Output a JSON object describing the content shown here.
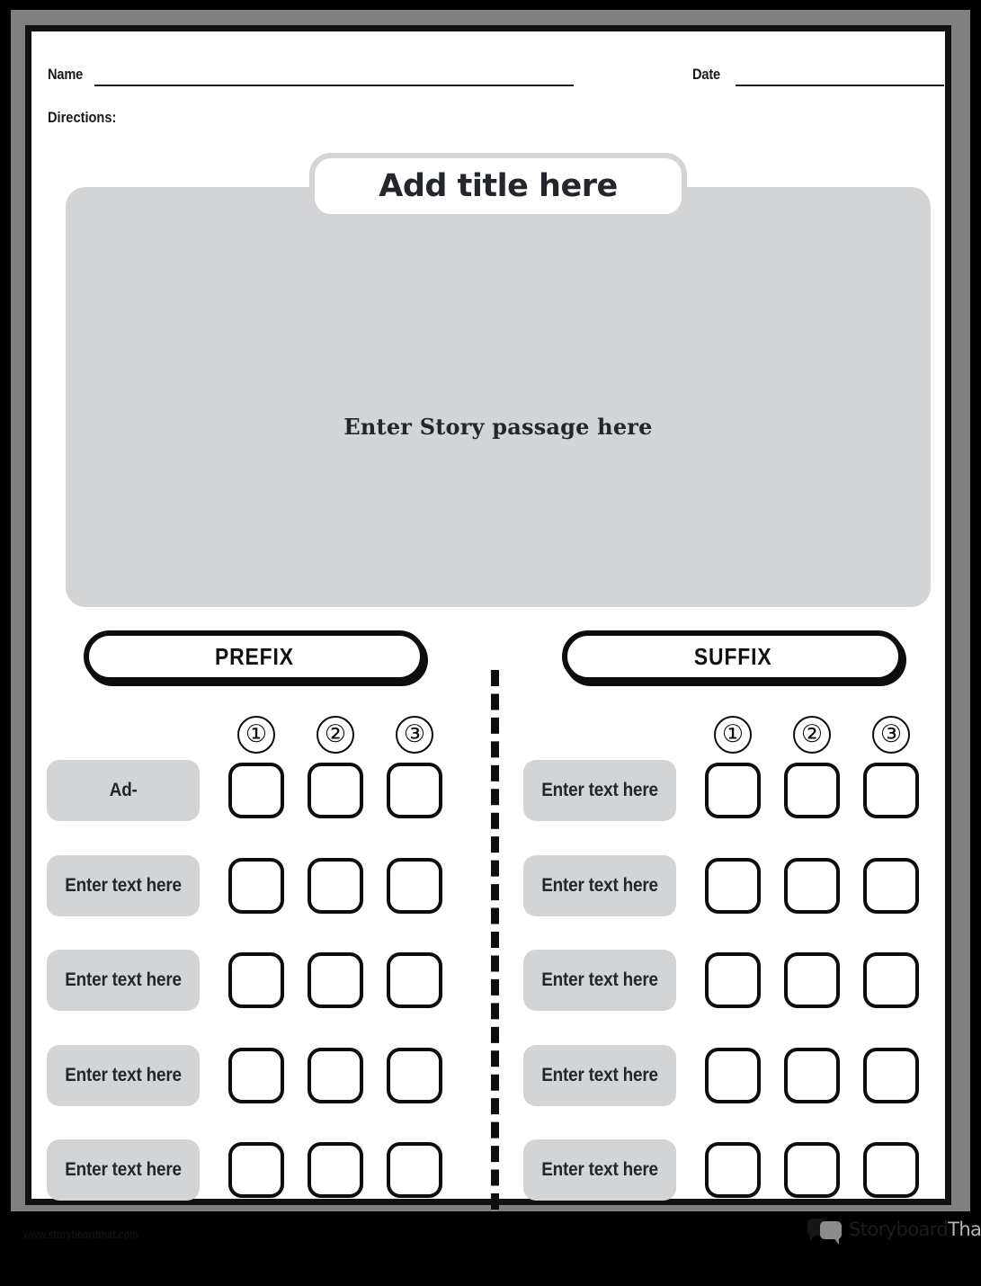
{
  "header": {
    "name_label": "Name",
    "date_label": "Date",
    "name_value": "",
    "date_value": "",
    "directions_label": "Directions:",
    "directions_value": ""
  },
  "title": {
    "placeholder": "Add title here"
  },
  "passage": {
    "placeholder": "Enter Story passage here"
  },
  "sections": {
    "prefix": {
      "heading": "PREFIX",
      "column_numbers": [
        "①",
        "②",
        "③"
      ],
      "rows": [
        {
          "term": "Ad-",
          "answers": [
            "",
            "",
            ""
          ]
        },
        {
          "term": "Enter text here",
          "answers": [
            "",
            "",
            ""
          ]
        },
        {
          "term": "Enter text here",
          "answers": [
            "",
            "",
            ""
          ]
        },
        {
          "term": "Enter text here",
          "answers": [
            "",
            "",
            ""
          ]
        },
        {
          "term": "Enter text here",
          "answers": [
            "",
            "",
            ""
          ]
        }
      ]
    },
    "suffix": {
      "heading": "SUFFIX",
      "column_numbers": [
        "①",
        "②",
        "③"
      ],
      "rows": [
        {
          "term": "Enter text here",
          "answers": [
            "",
            "",
            ""
          ]
        },
        {
          "term": "Enter text here",
          "answers": [
            "",
            "",
            ""
          ]
        },
        {
          "term": "Enter text here",
          "answers": [
            "",
            "",
            ""
          ]
        },
        {
          "term": "Enter text here",
          "answers": [
            "",
            "",
            ""
          ]
        },
        {
          "term": "Enter text here",
          "answers": [
            "",
            "",
            ""
          ]
        }
      ]
    }
  },
  "footer": {
    "url": "www.storyboardthat.com",
    "logo_primary": "Storyboard",
    "logo_secondary": "That"
  },
  "colors": {
    "page_background": "#000000",
    "mat": "#808080",
    "paper": "#ffffff",
    "border": "#111111",
    "chip_gray": "#d2d4d6",
    "ink": "#23262b"
  }
}
